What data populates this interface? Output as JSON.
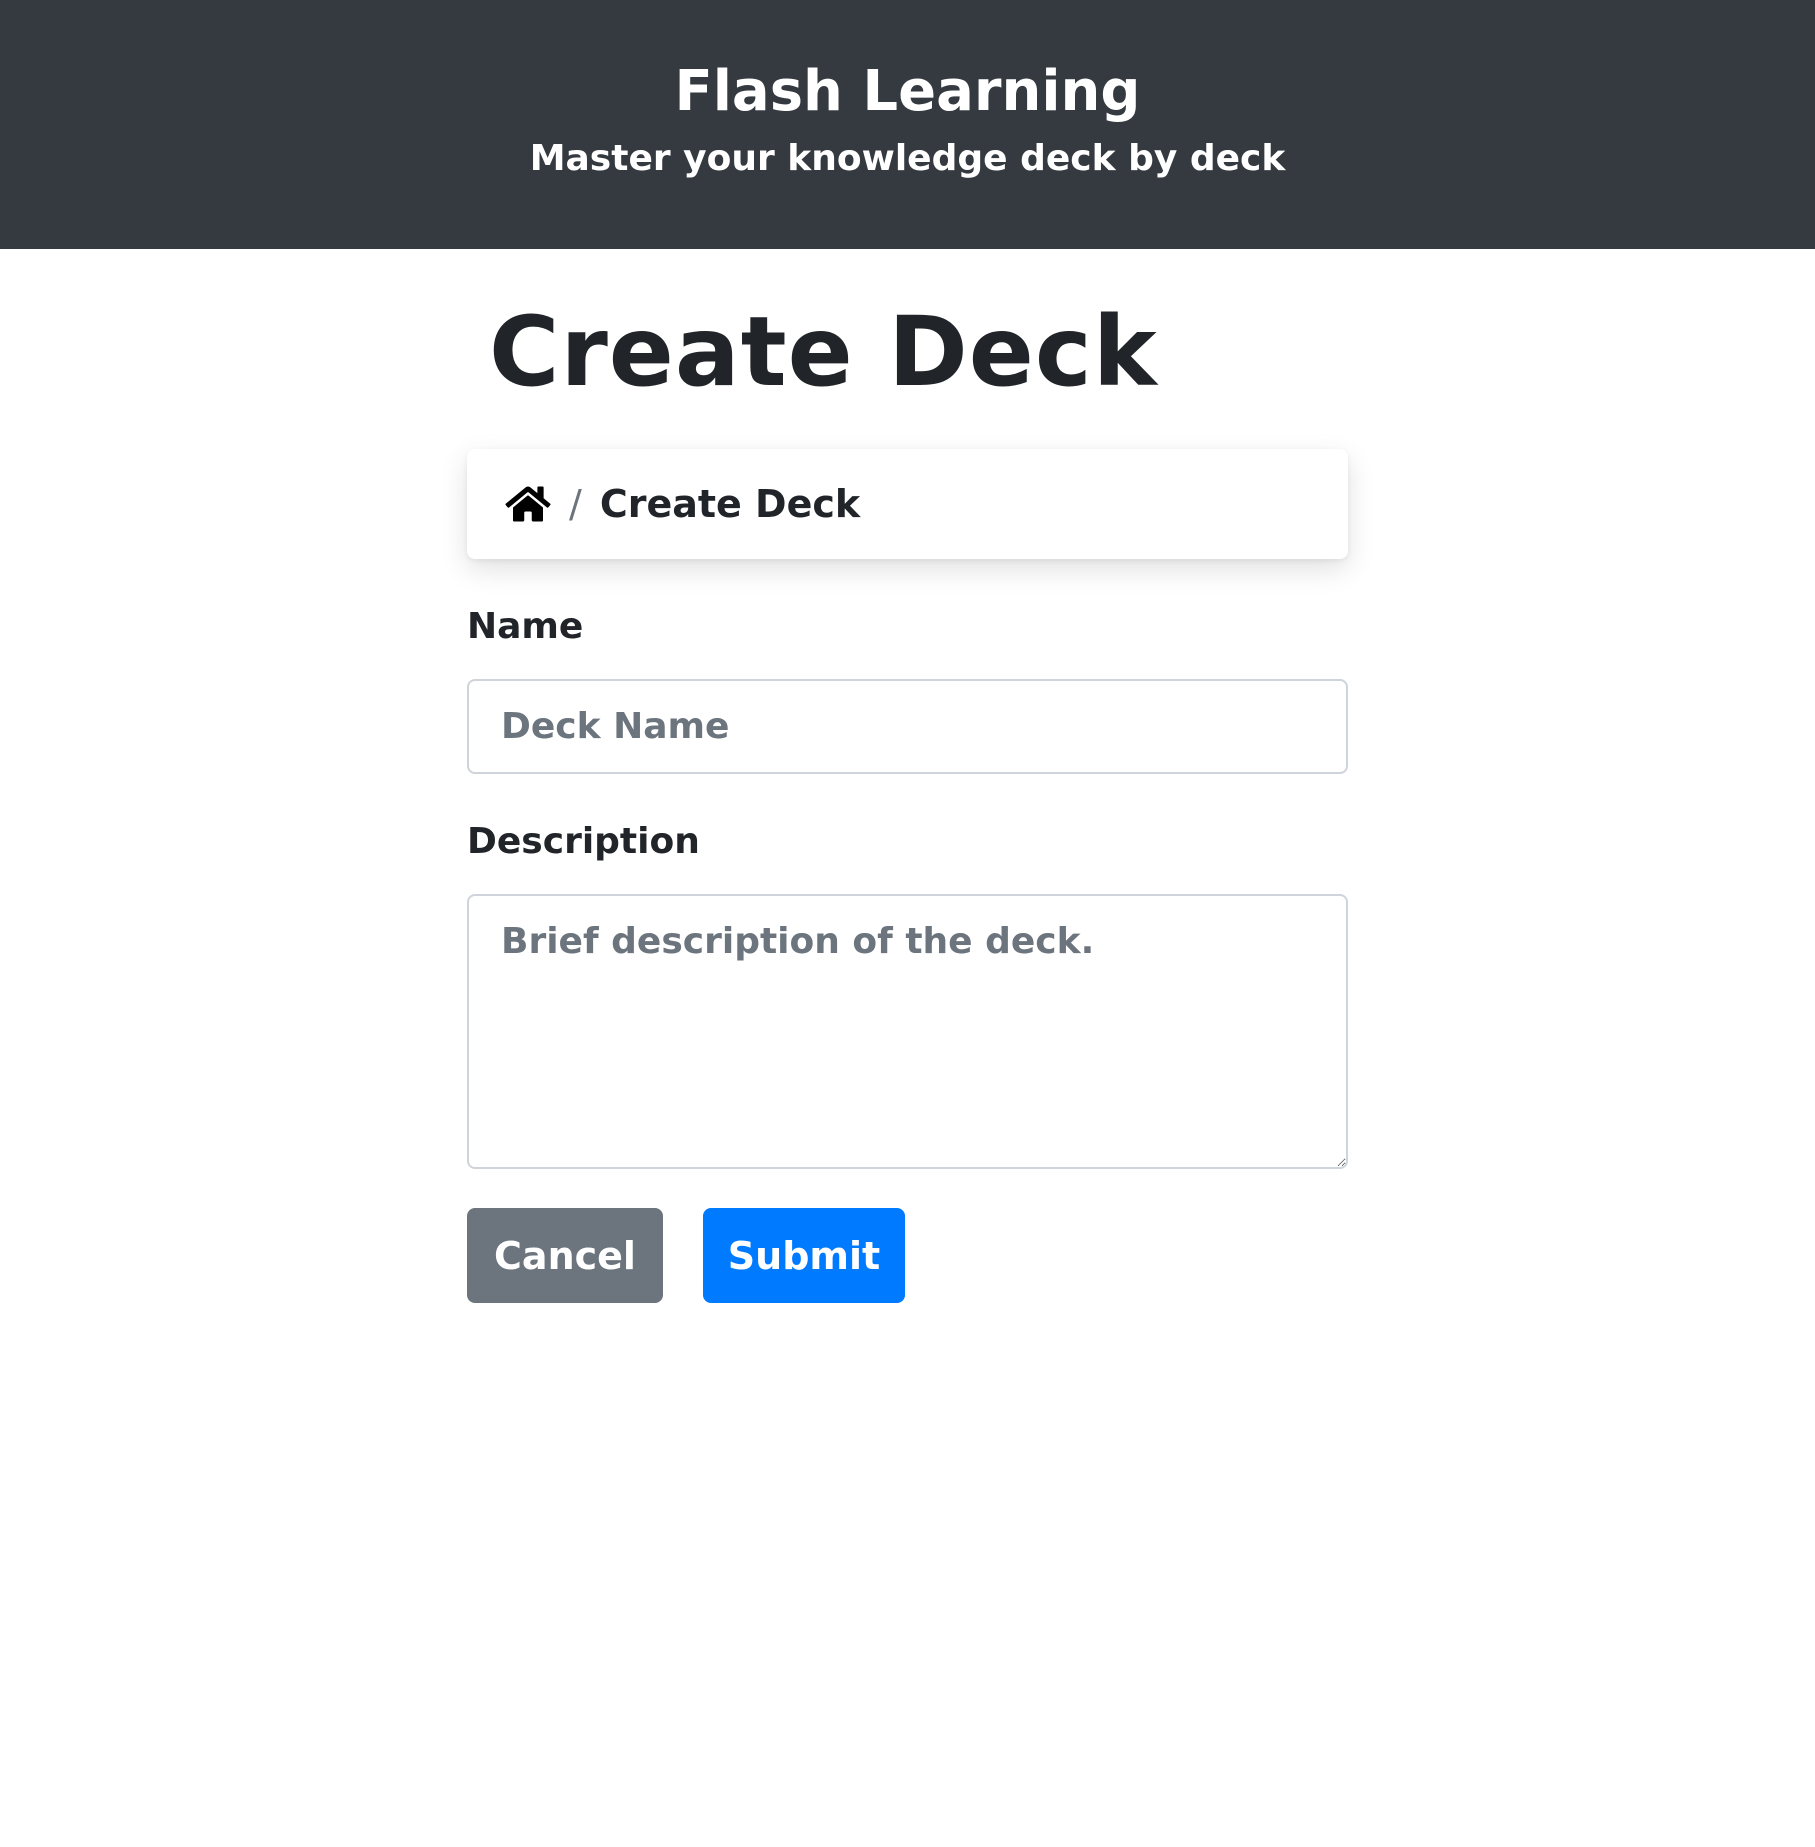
{
  "header": {
    "title": "Flash Learning",
    "subtitle": "Master your knowledge deck by deck"
  },
  "page": {
    "title": "Create Deck"
  },
  "breadcrumb": {
    "home_icon": "home-icon",
    "separator": "/",
    "current": "Create Deck"
  },
  "form": {
    "name_label": "Name",
    "name_value": "",
    "name_placeholder": "Deck Name",
    "description_label": "Description",
    "description_value": "",
    "description_placeholder": "Brief description of the deck.",
    "cancel_label": "Cancel",
    "submit_label": "Submit"
  },
  "colors": {
    "header_bg": "#343a40",
    "cancel_bg": "#6c757d",
    "submit_bg": "#007bff",
    "text": "#212529"
  }
}
